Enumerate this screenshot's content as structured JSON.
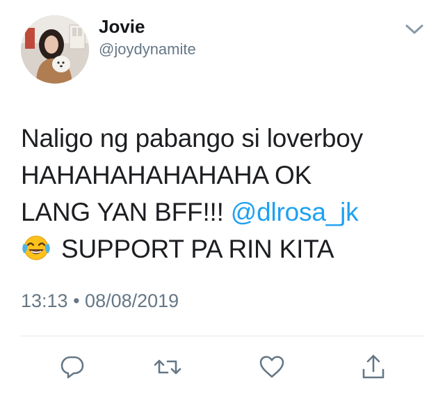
{
  "author": {
    "display_name": "Jovie",
    "handle": "@joydynamite",
    "avatar_icon": "profile-photo"
  },
  "tweet": {
    "line1": "Naligo ng pabango si loverboy",
    "line2": "HAHAHAHAHAHAHA OK",
    "line3_text": "LANG YAN BFF!!! ",
    "mention": "@dlrosa_jk",
    "emoji_icon": "face-with-tears-of-joy",
    "line4_text": "SUPPORT PA RIN KITA"
  },
  "meta": {
    "time": "13:13",
    "separator": " • ",
    "date": "08/08/2019"
  },
  "actions": {
    "reply_icon": "reply-icon",
    "retweet_icon": "retweet-icon",
    "like_icon": "heart-icon",
    "share_icon": "share-icon"
  },
  "colors": {
    "accent": "#1da1f2",
    "secondary_text": "#657786",
    "icon_gray": "#657786"
  }
}
